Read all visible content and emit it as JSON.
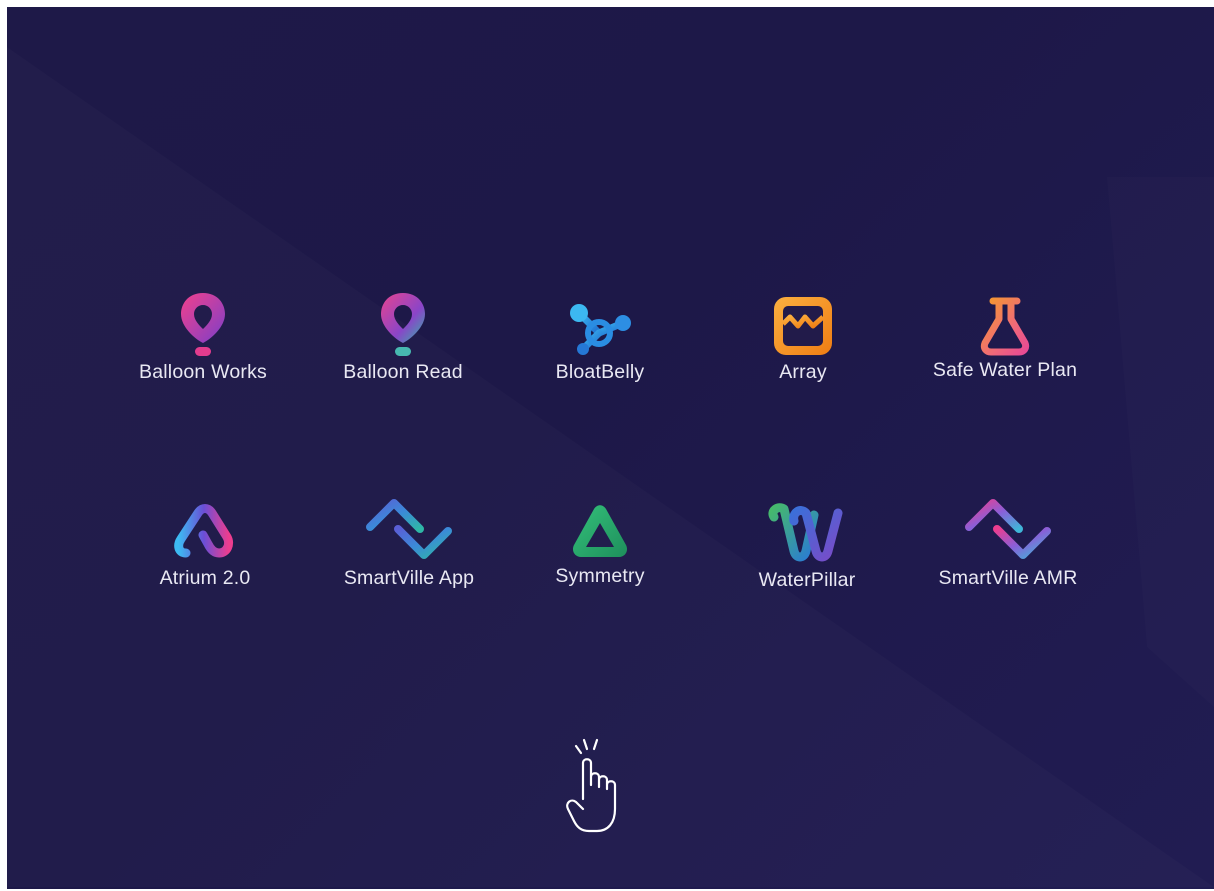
{
  "launcher": {
    "apps": [
      {
        "id": "balloon-works",
        "label": "Balloon Works",
        "icon": "balloon-pink-icon"
      },
      {
        "id": "balloon-read",
        "label": "Balloon Read",
        "icon": "balloon-teal-icon"
      },
      {
        "id": "bloatbelly",
        "label": "BloatBelly",
        "icon": "molecule-icon"
      },
      {
        "id": "array",
        "label": "Array",
        "icon": "array-wave-icon"
      },
      {
        "id": "safe-water-plan",
        "label": "Safe Water Plan",
        "icon": "flask-icon"
      },
      {
        "id": "atrium",
        "label": "Atrium 2.0",
        "icon": "atrium-a-icon"
      },
      {
        "id": "smartville-app",
        "label": "SmartVille App",
        "icon": "smartville-chevron-icon"
      },
      {
        "id": "symmetry",
        "label": "Symmetry",
        "icon": "triangle-icon"
      },
      {
        "id": "waterpillar",
        "label": "WaterPillar",
        "icon": "double-w-icon"
      },
      {
        "id": "smartville-amr",
        "label": "SmartVille AMR",
        "icon": "smartville-amr-chevron-icon"
      }
    ],
    "hint_icon": "tap-hand-icon"
  },
  "colors": {
    "background": "#1e1948",
    "text": "#e9e8f3",
    "pink": "#ec3d8f",
    "purple": "#8a45c8",
    "teal": "#2fb7a6",
    "blue": "#2b8be0",
    "orange": "#f39a1f",
    "green": "#25a567"
  }
}
